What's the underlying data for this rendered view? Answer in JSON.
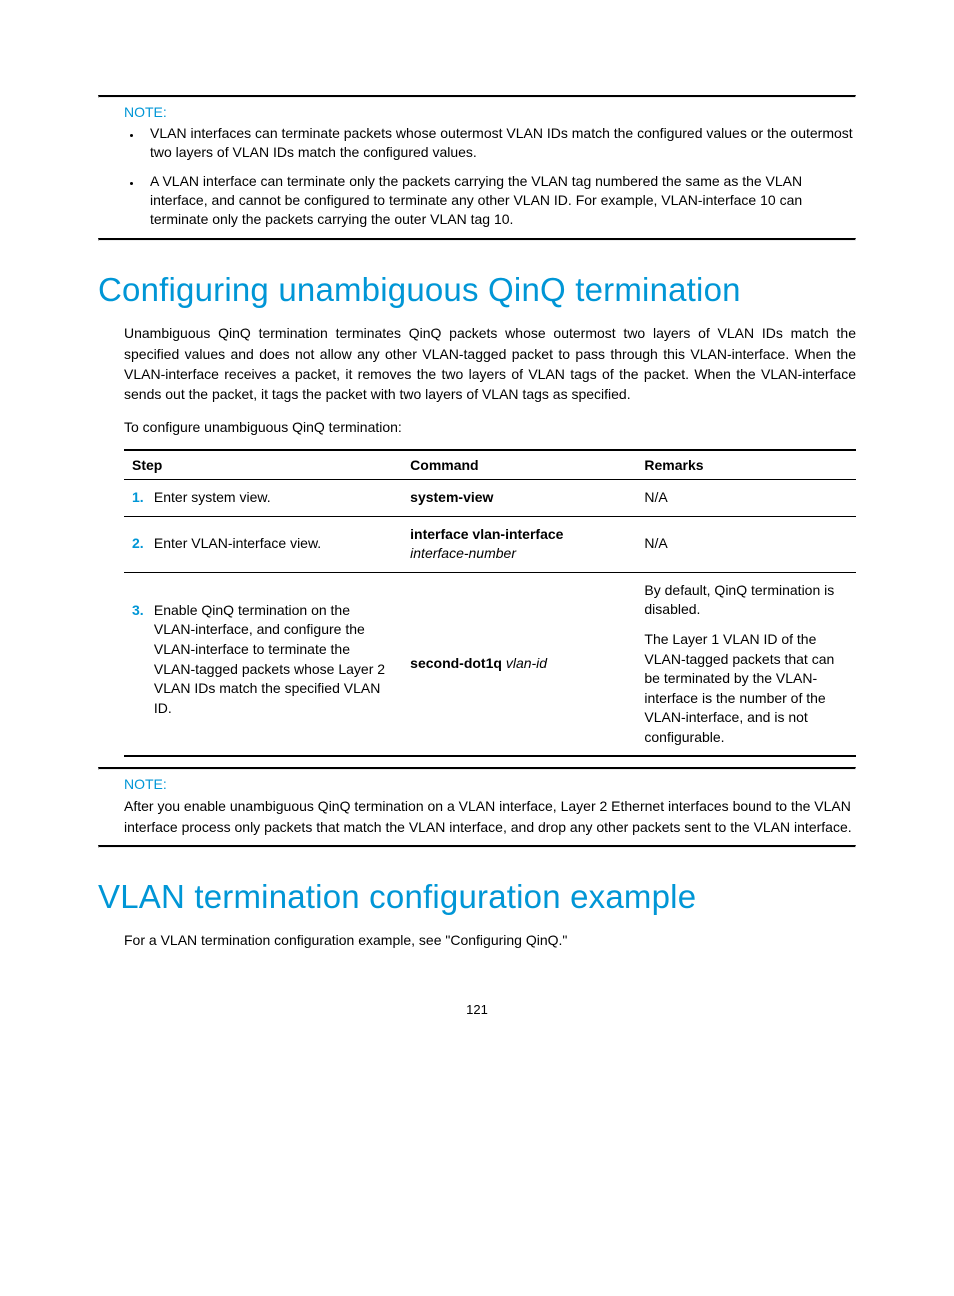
{
  "note1": {
    "label": "NOTE:",
    "bullets": [
      "VLAN interfaces can terminate packets whose outermost VLAN IDs match the configured values or the outermost two layers of VLAN IDs match the configured values.",
      "A VLAN interface can terminate only the packets carrying the VLAN tag numbered the same as the VLAN interface, and cannot be configured to terminate any other VLAN ID. For example, VLAN-interface 10 can terminate only the packets carrying the outer VLAN tag 10."
    ]
  },
  "h_qinq": "Configuring unambiguous QinQ termination",
  "qinq_intro": "Unambiguous QinQ termination terminates QinQ packets whose outermost two layers of VLAN IDs match the specified values and does not allow any other VLAN-tagged packet to pass through this VLAN-interface. When the VLAN-interface receives a packet, it removes the two layers of VLAN tags of the packet. When the VLAN-interface sends out the packet, it tags the packet with two layers of VLAN tags as specified.",
  "qinq_lead": "To configure unambiguous QinQ termination:",
  "table": {
    "headers": {
      "step": "Step",
      "command": "Command",
      "remarks": "Remarks"
    },
    "rows": [
      {
        "num": "1.",
        "step": "Enter system view.",
        "cmd_bold": "system-view",
        "cmd_ital": "",
        "remarks": "N/A"
      },
      {
        "num": "2.",
        "step": "Enter VLAN-interface view.",
        "cmd_bold": "interface vlan-interface",
        "cmd_ital": "interface-number",
        "remarks": "N/A"
      },
      {
        "num": "3.",
        "step": "Enable QinQ termination on the VLAN-interface, and configure the VLAN-interface to terminate the VLAN-tagged packets whose Layer 2 VLAN IDs match the specified VLAN ID.",
        "cmd_bold": "second-dot1q",
        "cmd_ital": "vlan-id",
        "remarks_p1": "By default, QinQ termination is disabled.",
        "remarks_p2": "The Layer 1 VLAN ID of the VLAN-tagged packets that can be terminated by the VLAN-interface is the number of the VLAN-interface, and is not configurable."
      }
    ]
  },
  "note2": {
    "label": "NOTE:",
    "text": "After you enable unambiguous QinQ termination on a VLAN interface, Layer 2 Ethernet interfaces bound to the VLAN interface process only packets that match the VLAN interface, and drop any other packets sent to the VLAN interface."
  },
  "h_example": "VLAN termination configuration example",
  "example_text": "For a VLAN termination configuration example, see \"Configuring QinQ.\"",
  "page_number": "121"
}
